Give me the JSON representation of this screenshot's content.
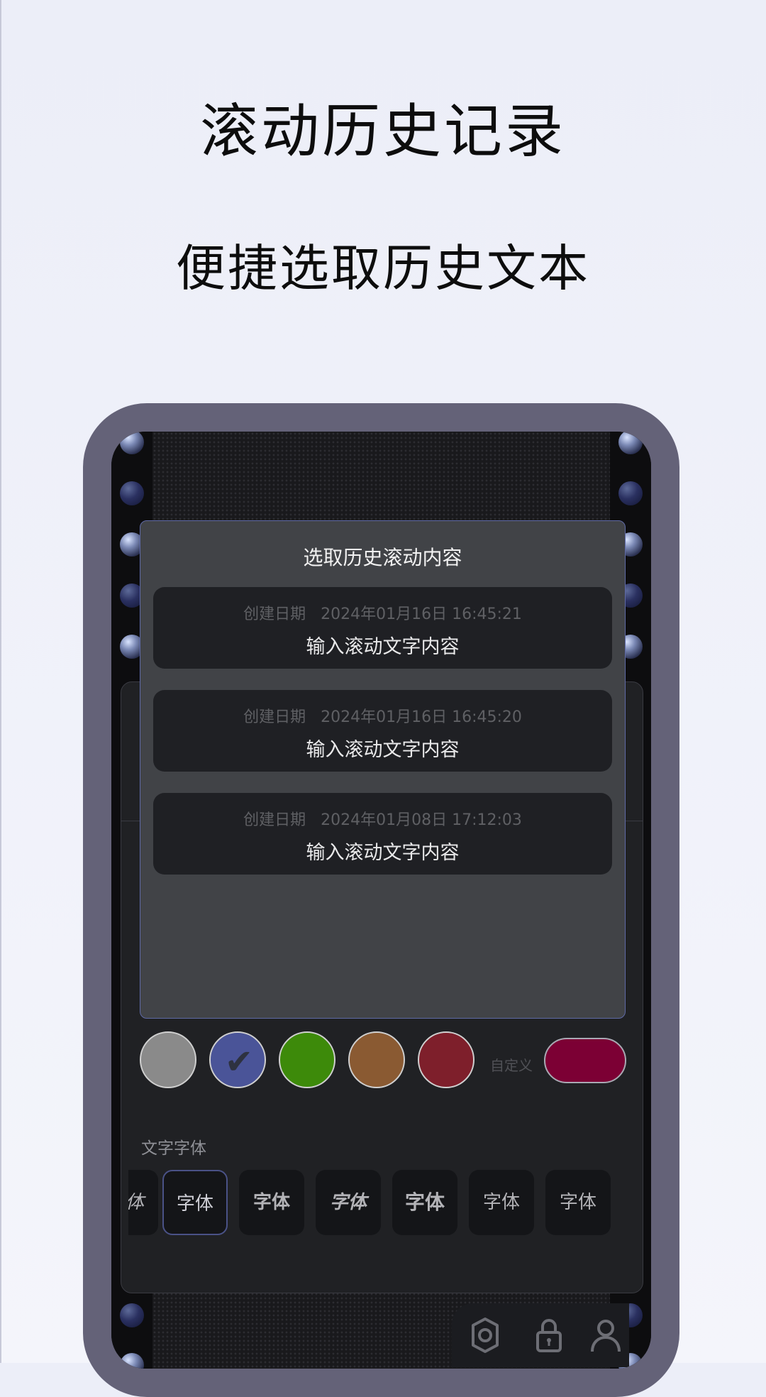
{
  "promo": {
    "title": "滚动历史记录",
    "subtitle": "便捷选取历史文本"
  },
  "dialog": {
    "title": "选取历史滚动内容",
    "items": [
      {
        "date_label": "创建日期",
        "date": "2024年01月16日 16:45:21",
        "text": "输入滚动文字内容"
      },
      {
        "date_label": "创建日期",
        "date": "2024年01月16日 16:45:20",
        "text": "输入滚动文字内容"
      },
      {
        "date_label": "创建日期",
        "date": "2024年01月08日 17:12:03",
        "text": "输入滚动文字内容"
      }
    ]
  },
  "colors": {
    "swatches": [
      "#8a8a8a",
      "#4a5498",
      "#3d8a0a",
      "#8a5a32",
      "#7e1f2b"
    ],
    "selected_index": 1,
    "custom_label": "自定义",
    "custom_color": "#7c0034"
  },
  "fonts": {
    "section_label": "文字字体",
    "options": [
      "字体",
      "字体",
      "字体",
      "字体",
      "字体",
      "字体",
      "字体"
    ],
    "selected_index": 1
  },
  "toolbar": {
    "icons": [
      "settings-icon",
      "lock-icon",
      "user-icon"
    ]
  }
}
